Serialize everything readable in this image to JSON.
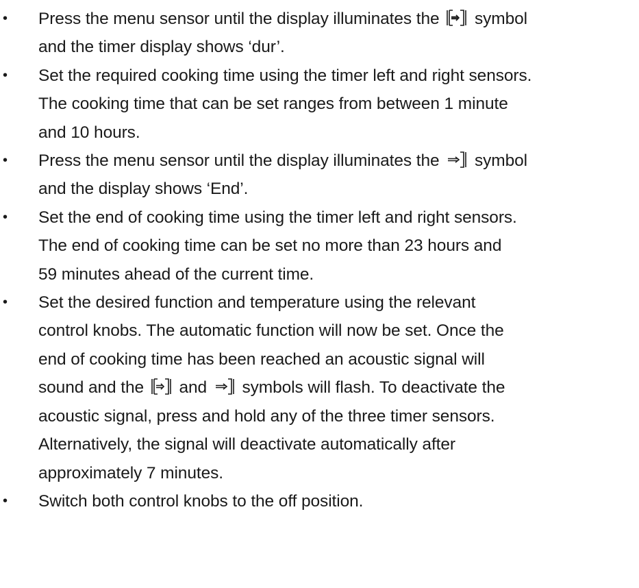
{
  "bullet": "•",
  "steps": [
    {
      "lines": [
        [
          "Press the menu sensor until the display illuminates the",
          "symbol"
        ],
        [
          "and the timer display shows ‘dur’."
        ]
      ]
    },
    {
      "lines": [
        [
          "Set the required cooking time using the timer left and right sensors."
        ],
        [
          "The cooking time that can be set ranges from between 1 minute"
        ],
        [
          "and 10 hours."
        ]
      ]
    },
    {
      "lines": [
        [
          "Press the menu sensor until the display illuminates the",
          "symbol"
        ],
        [
          "and the display shows ‘End’."
        ]
      ]
    },
    {
      "lines": [
        [
          "Set the end of cooking time using the timer left and right sensors."
        ],
        [
          "The end of cooking time can be set no more than 23 hours and"
        ],
        [
          "59 minutes ahead of the current time."
        ]
      ]
    },
    {
      "lines": [
        [
          "Set the desired function and temperature using the relevant"
        ],
        [
          "control knobs. The automatic function will now be set. Once the"
        ],
        [
          "end of cooking time has been reached an acoustic signal will"
        ],
        [
          "sound and the",
          "and",
          "symbols will flash. To deactivate the"
        ],
        [
          "acoustic signal, press and hold any of the three timer sensors."
        ],
        [
          "Alternatively, the signal will deactivate automatically after"
        ],
        [
          "approximately 7 minutes."
        ]
      ]
    },
    {
      "lines": [
        [
          "Switch both control knobs to the off position."
        ]
      ]
    }
  ],
  "icons": {
    "duration": "duration-symbol-icon",
    "end_time": "end-time-symbol-icon"
  }
}
